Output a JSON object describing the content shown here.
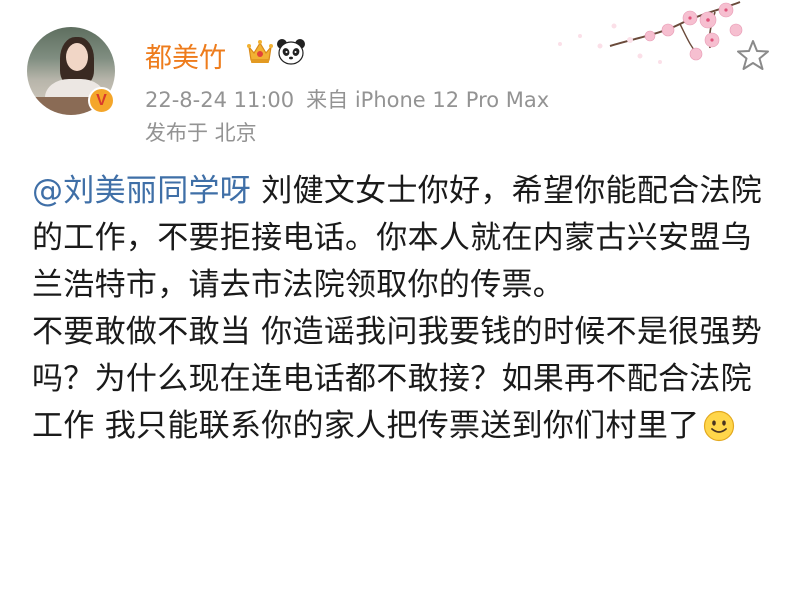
{
  "user": {
    "name": "都美竹",
    "avatar_icon": "avatar-photo",
    "badges": [
      "crown-icon",
      "panda-icon"
    ],
    "verified_badge_glyph": "V"
  },
  "meta": {
    "timestamp": "22-8-24 11:00",
    "source": "来自 iPhone 12 Pro Max",
    "location": "发布于 北京"
  },
  "post": {
    "mention": "@刘美丽同学呀",
    "paragraph1_rest": " 刘健文女士你好，希望你能配合法院的工作，不要拒接电话。你本人就在内蒙古兴安盟乌兰浩特市，请去市法院领取你的传票。",
    "paragraph2": "不要敢做不敢当 你造谣我问我要钱的时候不是很强势吗？为什么现在连电话都不敢接？如果再不配合法院工作 我只能联系你的家人把传票送到你们村里了",
    "end_emoji": "smile-emoji"
  },
  "colors": {
    "username": "#ee7c1c",
    "mention": "#3f6fa7",
    "meta": "#939393",
    "text": "#1a1a1a"
  }
}
